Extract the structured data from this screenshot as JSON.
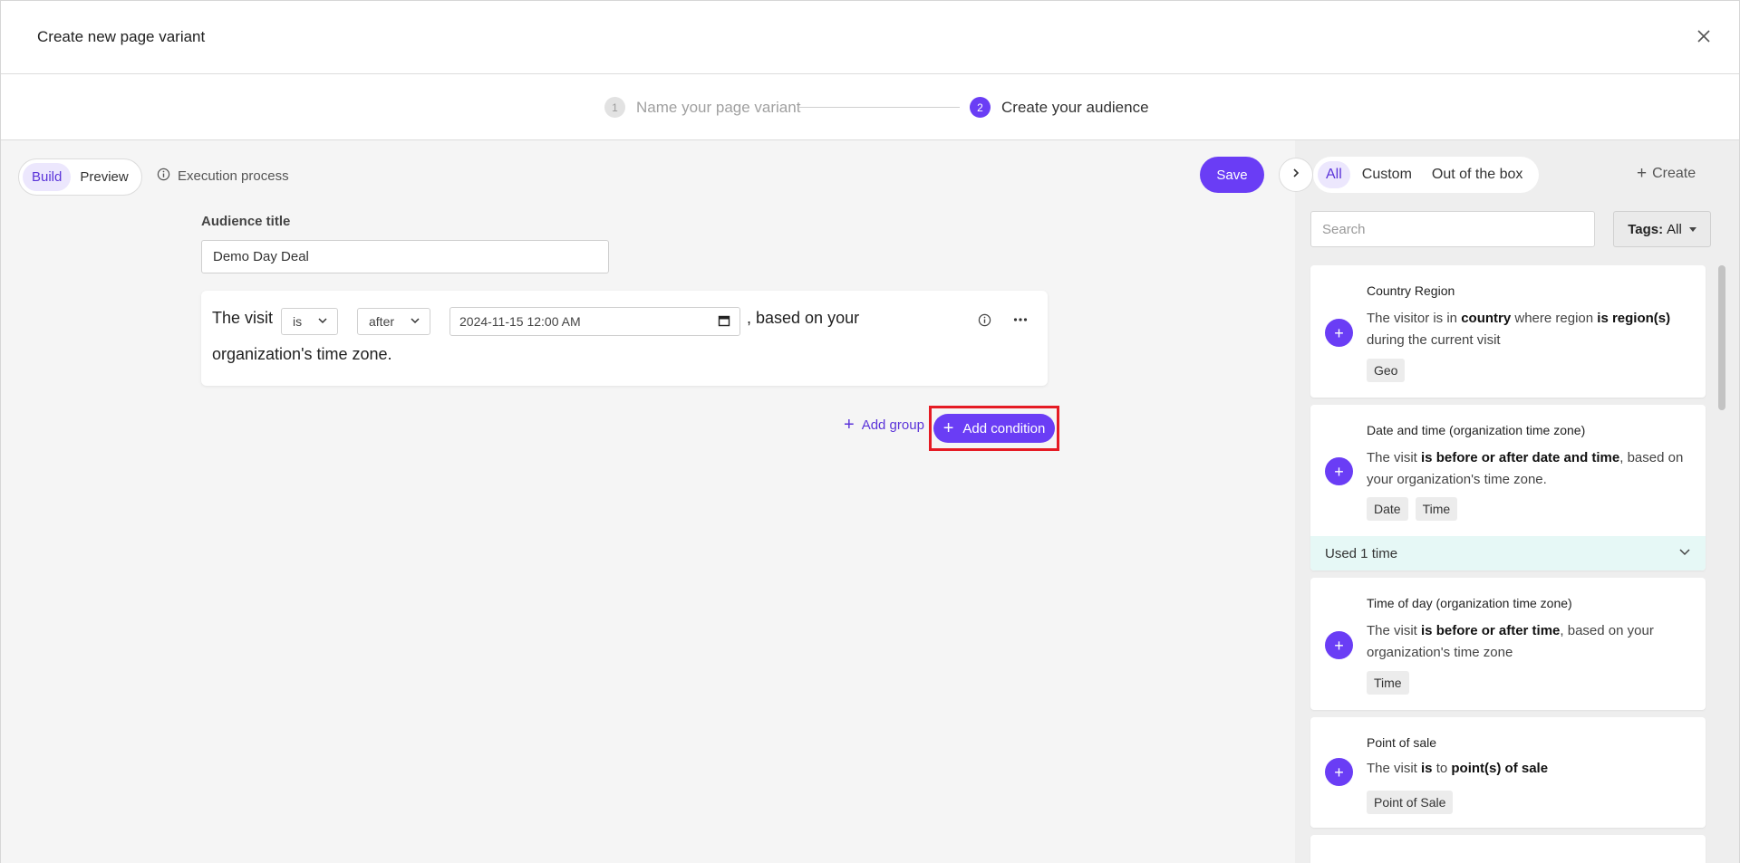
{
  "modal": {
    "title": "Create new page variant"
  },
  "stepper": {
    "steps": [
      {
        "number": "1",
        "label": "Name your page variant"
      },
      {
        "number": "2",
        "label": "Create your audience"
      }
    ]
  },
  "toolbar": {
    "modes": [
      "Build",
      "Preview"
    ],
    "active_mode": "Build",
    "execution_process": "Execution process",
    "save": "Save"
  },
  "audience": {
    "title_label": "Audience title",
    "title_value": "Demo Day Deal"
  },
  "condition": {
    "prefix": "The visit",
    "operator": "is",
    "relation": "after",
    "datetime": "2024-11-15 12:00  AM",
    "suffix_1": ", based on your",
    "suffix_2": "organization's time zone."
  },
  "actions": {
    "add_group": "Add group",
    "add_condition": "Add condition"
  },
  "panel": {
    "tabs": [
      "All",
      "Custom",
      "Out of the box"
    ],
    "active_tab": "All",
    "create": "Create",
    "search_placeholder": "Search",
    "tags_label": "Tags:",
    "tags_value": "All",
    "templates": [
      {
        "title": "Country Region",
        "desc": [
          {
            "t": "The visitor is in ",
            "b": false
          },
          {
            "t": "country",
            "b": true
          },
          {
            "t": " where region ",
            "b": false
          },
          {
            "t": "is region(s)",
            "b": true
          },
          {
            "t": " during the current visit",
            "b": false
          }
        ],
        "tags": [
          "Geo"
        ],
        "used": ""
      },
      {
        "title": "Date and time (organization time zone)",
        "desc": [
          {
            "t": "The visit ",
            "b": false
          },
          {
            "t": "is before or after date and time",
            "b": true
          },
          {
            "t": ", based on your organization's time zone.",
            "b": false
          }
        ],
        "tags": [
          "Date",
          "Time"
        ],
        "used": "Used 1 time"
      },
      {
        "title": "Time of day (organization time zone)",
        "desc": [
          {
            "t": "The visit ",
            "b": false
          },
          {
            "t": "is before or after time",
            "b": true
          },
          {
            "t": ", based on your organization's time zone",
            "b": false
          }
        ],
        "tags": [
          "Time"
        ],
        "used": ""
      },
      {
        "title": "Point of sale",
        "desc": [
          {
            "t": "The visit ",
            "b": false
          },
          {
            "t": "is",
            "b": true
          },
          {
            "t": " to ",
            "b": false
          },
          {
            "t": "point(s) of sale",
            "b": true
          }
        ],
        "tags": [
          "Point of Sale"
        ],
        "used": ""
      }
    ]
  },
  "colors": {
    "accent": "#6a3df5",
    "highlight_box": "#e51b24",
    "used_strip": "#e6f8f6"
  },
  "icons": {
    "close": "close-icon",
    "info": "info-icon",
    "more": "more-horizontal-icon",
    "chevron": "chevron-right-icon",
    "calendar": "calendar-icon",
    "chevron_down": "chevron-down-icon",
    "plus": "plus-icon"
  }
}
